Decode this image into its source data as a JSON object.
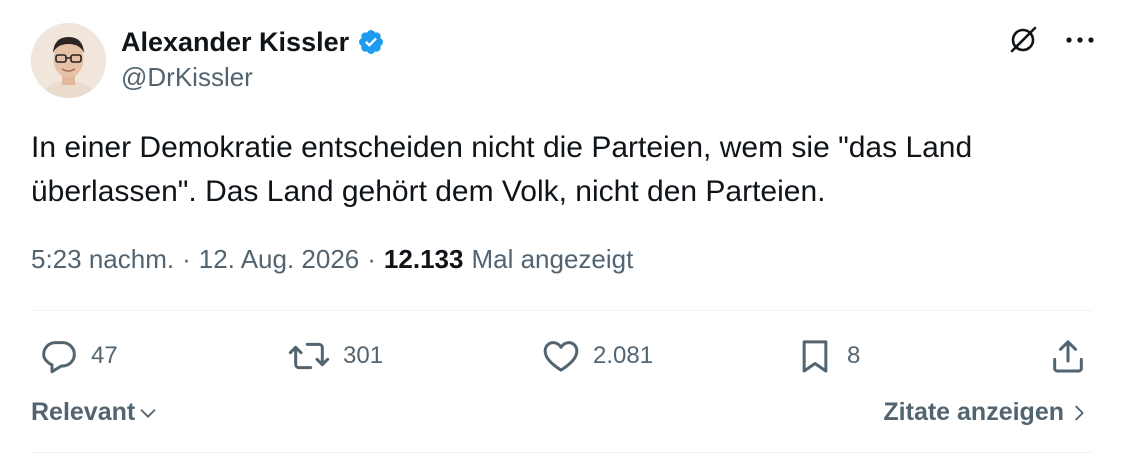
{
  "author": {
    "name": "Alexander Kissler",
    "handle": "@DrKissler",
    "verified": true,
    "avatar_icon": "profile-photo"
  },
  "tweet": {
    "text": "In einer Demokratie entscheiden nicht die Parteien, wem sie \"das Land\nüberlassen\". Das Land gehört dem Volk, nicht den Parteien."
  },
  "meta": {
    "time": "5:23 nachm.",
    "separator": "·",
    "date": "12. Aug. 2026",
    "views": "12.133",
    "views_label": "Mal angezeigt"
  },
  "actions": {
    "replies": "47",
    "reposts": "301",
    "likes": "2.081",
    "bookmarks": "8"
  },
  "footer": {
    "sort_label": "Relevant",
    "quotes_label": "Zitate anzeigen"
  },
  "colors": {
    "text": "#0f1419",
    "secondary": "#536471",
    "verified_blue": "#1d9bf0",
    "divider": "#eff3f4"
  }
}
